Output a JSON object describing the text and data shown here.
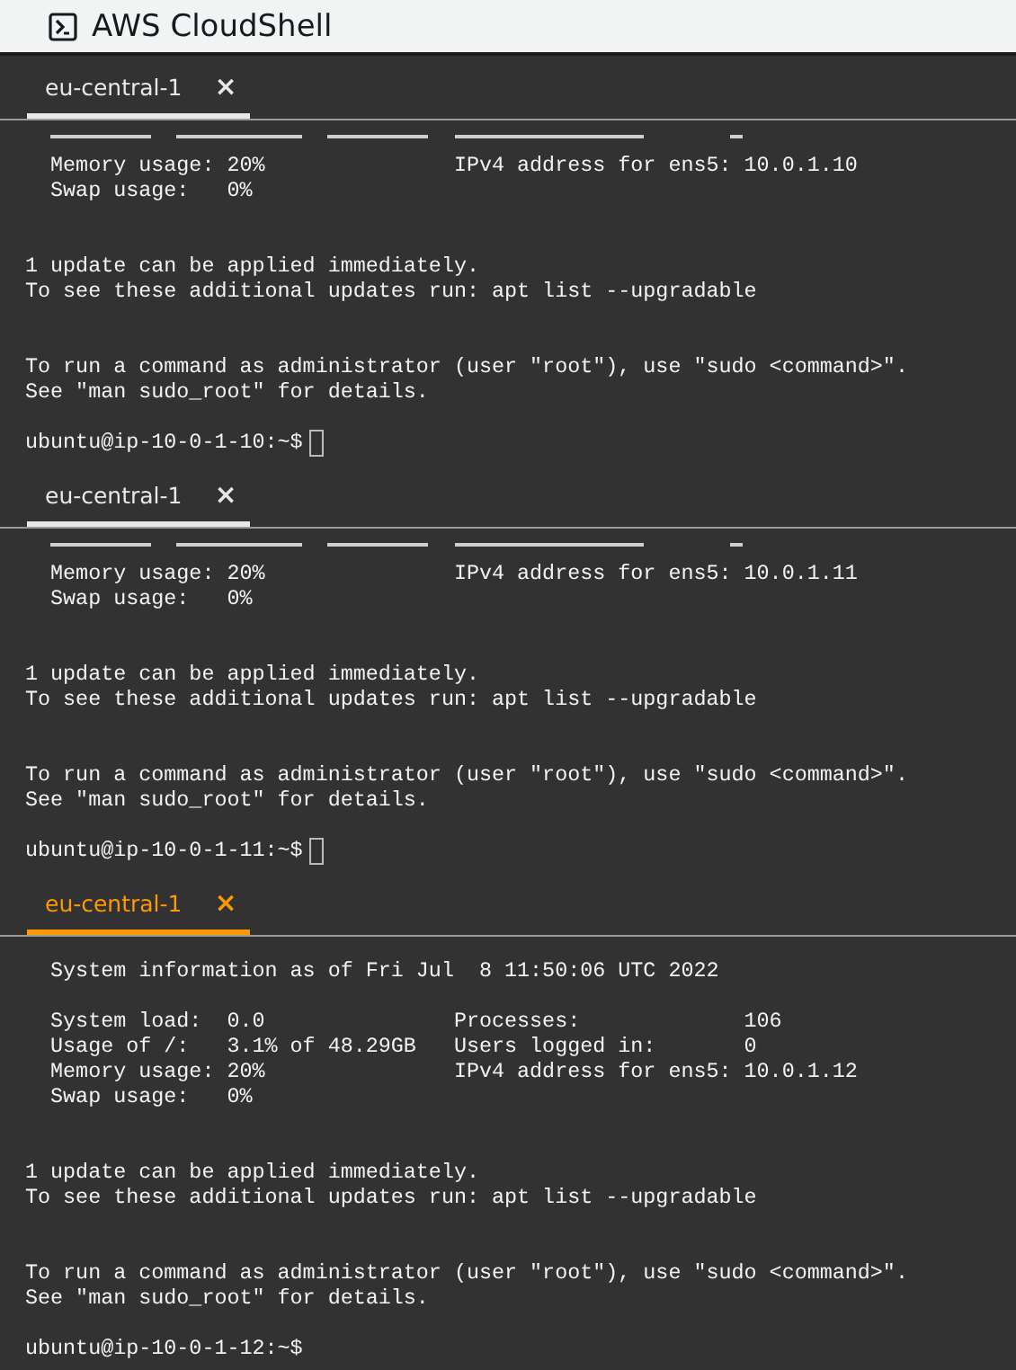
{
  "header": {
    "title": "AWS CloudShell"
  },
  "panes": [
    {
      "tab": {
        "label": "eu-central-1",
        "close": "×",
        "selected": false
      },
      "scrolled": true,
      "cursor_shown": true,
      "blocks": [
        {
          "kind": "info",
          "lines": [
            "  Memory usage: 20%               IPv4 address for ens5: 10.0.1.10",
            "  Swap usage:   0%"
          ]
        },
        {
          "kind": "info",
          "lines": [
            "1 update can be applied immediately.",
            "To see these additional updates run: apt list --upgradable"
          ]
        },
        {
          "kind": "note",
          "lines": [
            "To run a command as administrator (user \"root\"), use \"sudo <command>\".",
            "See \"man sudo_root\" for details."
          ]
        },
        {
          "kind": "prompt",
          "lines": [
            "ubuntu@ip-10-0-1-10:~$"
          ]
        }
      ]
    },
    {
      "tab": {
        "label": "eu-central-1",
        "close": "×",
        "selected": false
      },
      "scrolled": true,
      "cursor_shown": true,
      "blocks": [
        {
          "kind": "info",
          "lines": [
            "  Memory usage: 20%               IPv4 address for ens5: 10.0.1.11",
            "  Swap usage:   0%"
          ]
        },
        {
          "kind": "info",
          "lines": [
            "1 update can be applied immediately.",
            "To see these additional updates run: apt list --upgradable"
          ]
        },
        {
          "kind": "note",
          "lines": [
            "To run a command as administrator (user \"root\"), use \"sudo <command>\".",
            "See \"man sudo_root\" for details."
          ]
        },
        {
          "kind": "prompt",
          "lines": [
            "ubuntu@ip-10-0-1-11:~$"
          ]
        }
      ]
    },
    {
      "tab": {
        "label": "eu-central-1",
        "close": "×",
        "selected": true
      },
      "scrolled": false,
      "cursor_shown": false,
      "blocks": [
        {
          "kind": "note",
          "lines": [
            "  System information as of Fri Jul  8 11:50:06 UTC 2022"
          ]
        },
        {
          "kind": "info",
          "lines": [
            "  System load:  0.0               Processes:             106",
            "  Usage of /:   3.1% of 48.29GB   Users logged in:       0",
            "  Memory usage: 20%               IPv4 address for ens5: 10.0.1.12",
            "  Swap usage:   0%"
          ]
        },
        {
          "kind": "info",
          "lines": [
            "1 update can be applied immediately.",
            "To see these additional updates run: apt list --upgradable"
          ]
        },
        {
          "kind": "note",
          "lines": [
            "To run a command as administrator (user \"root\"), use \"sudo <command>\".",
            "See \"man sudo_root\" for details."
          ]
        },
        {
          "kind": "prompt",
          "lines": [
            "ubuntu@ip-10-0-1-12:~$"
          ]
        }
      ]
    }
  ]
}
